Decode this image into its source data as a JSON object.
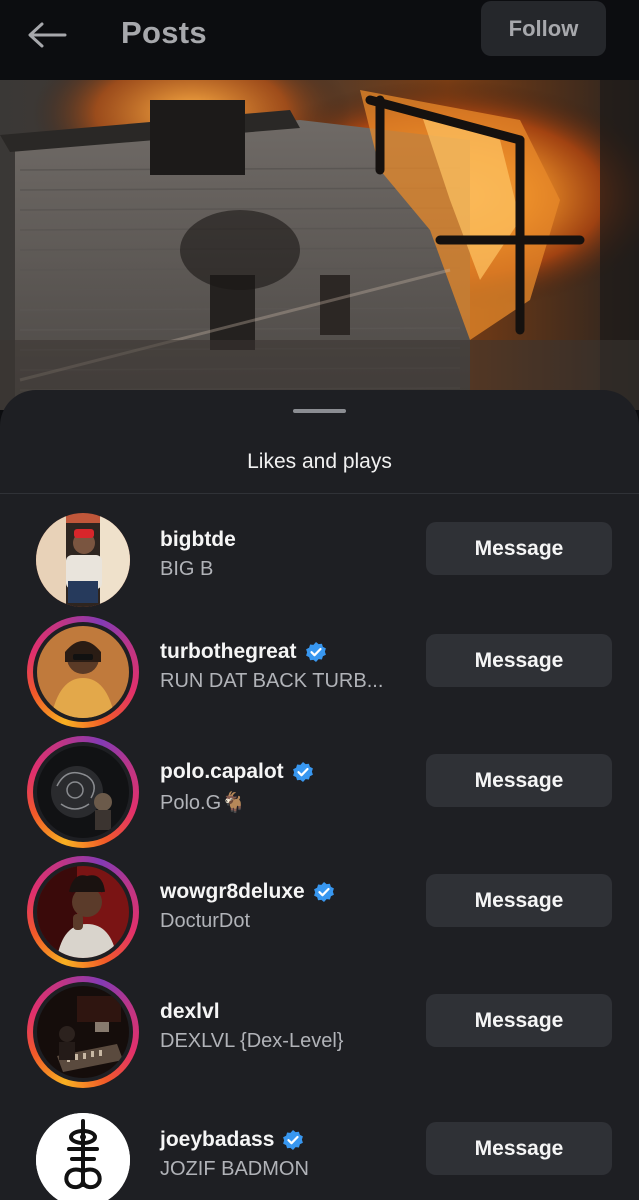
{
  "header": {
    "back_icon": "arrow-left-icon",
    "title": "Posts",
    "follow_label": "Follow"
  },
  "sheet": {
    "title": "Likes and plays"
  },
  "colors": {
    "background": "#0c0d10",
    "sheet": "#1e1f23",
    "button": "#2f3136",
    "verified": "#3897f0"
  },
  "likers": [
    {
      "username": "bigbtde",
      "display_name": "BIG B",
      "verified": false,
      "story_ring": false,
      "button": "Message"
    },
    {
      "username": "turbothegreat",
      "display_name": "RUN DAT BACK TURB...",
      "verified": true,
      "story_ring": true,
      "button": "Message"
    },
    {
      "username": "polo.capalot",
      "display_name": "Polo.G🐐",
      "verified": true,
      "story_ring": true,
      "button": "Message"
    },
    {
      "username": "wowgr8deluxe",
      "display_name": "DocturDot",
      "verified": true,
      "story_ring": true,
      "button": "Message"
    },
    {
      "username": "dexlvl",
      "display_name": "DEXLVL {Dex-Level}",
      "verified": false,
      "story_ring": true,
      "button": "Message"
    },
    {
      "username": "joeybadass",
      "display_name": "JOZIF BADMON",
      "verified": true,
      "story_ring": false,
      "button": "Message"
    }
  ]
}
